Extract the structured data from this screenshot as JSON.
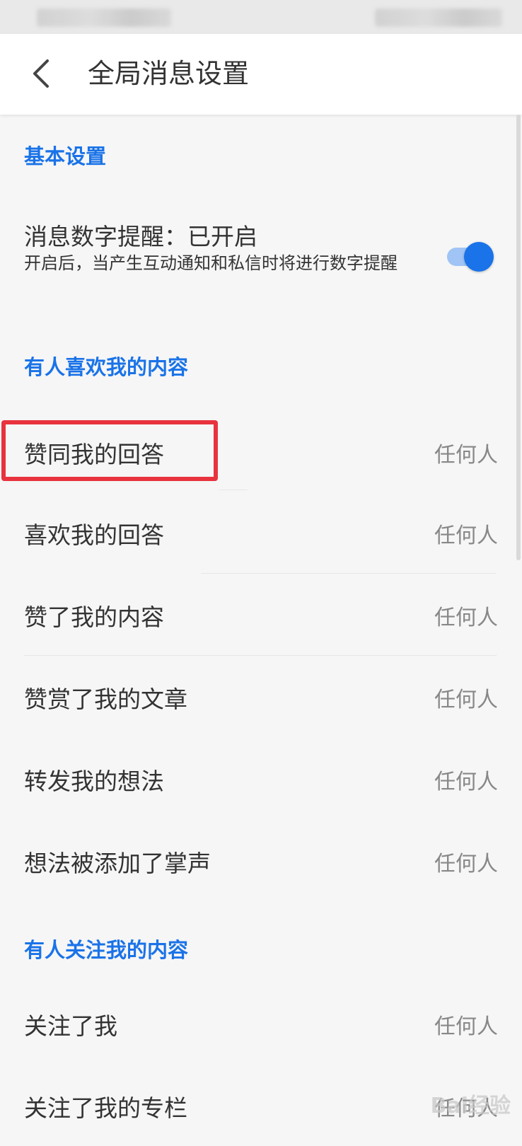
{
  "header": {
    "title": "全局消息设置"
  },
  "sections": {
    "basic": {
      "title": "基本设置",
      "badge_setting": {
        "label": "消息数字提醒：已开启",
        "description": "开启后，当产生互动通知和私信时将进行数字提醒",
        "enabled": true
      }
    },
    "likes": {
      "title": "有人喜欢我的内容",
      "items": [
        {
          "label": "赞同我的回答",
          "value": "任何人"
        },
        {
          "label": "喜欢我的回答",
          "value": "任何人"
        },
        {
          "label": "赞了我的内容",
          "value": "任何人"
        },
        {
          "label": "赞赏了我的文章",
          "value": "任何人"
        },
        {
          "label": "转发我的想法",
          "value": "任何人"
        },
        {
          "label": "想法被添加了掌声",
          "value": "任何人"
        }
      ]
    },
    "follows": {
      "title": "有人关注我的内容",
      "items": [
        {
          "label": "关注了我",
          "value": "任何人"
        },
        {
          "label": "关注了我的专栏",
          "value": "任何人"
        }
      ]
    }
  },
  "watermark": "Bai经验",
  "colors": {
    "accent": "#1a73e8",
    "highlight": "#e8333e"
  }
}
